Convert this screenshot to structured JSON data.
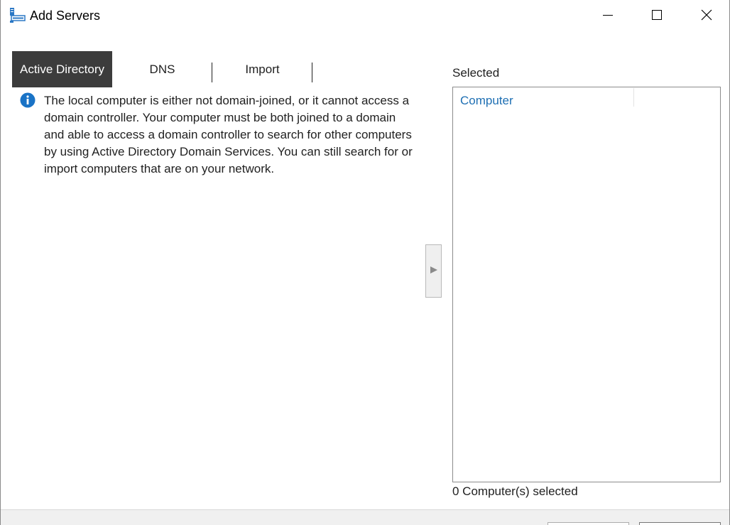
{
  "window": {
    "title": "Add Servers",
    "icon": "server-manager-icon",
    "controls": {
      "minimize_icon": "minimize-icon",
      "maximize_icon": "maximize-icon",
      "close_icon": "close-icon"
    }
  },
  "tabs": [
    {
      "label": "Active Directory",
      "active": true
    },
    {
      "label": "DNS",
      "active": false
    },
    {
      "label": "Import",
      "active": false
    }
  ],
  "info": {
    "icon": "info-icon",
    "message": "The local computer is either not domain-joined, or it cannot access a domain controller. Your computer must be both joined to a domain and able to access a domain controller to search for other computers by using Active Directory Domain Services. You can still search for or import computers that are on your network."
  },
  "add_button": {
    "icon": "arrow-right-icon",
    "glyph": "▶"
  },
  "selected": {
    "label": "Selected",
    "columns": [
      "Computer"
    ],
    "count_text": "0 Computer(s) selected"
  },
  "colors": {
    "active_tab_bg": "#3c3c3c",
    "link_blue": "#1e6fb3",
    "info_blue": "#1a73c6"
  }
}
